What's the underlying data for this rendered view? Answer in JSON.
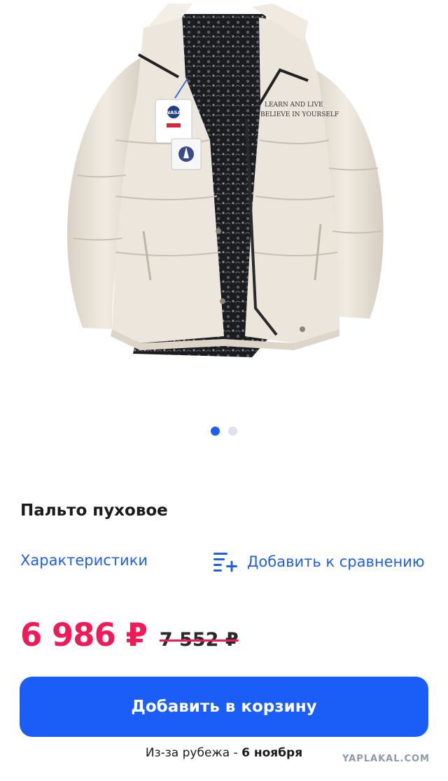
{
  "product": {
    "jacket_print_line1": "LEARN AND LIVE",
    "jacket_print_line2": "BELIEVE IN YOURSELF",
    "tag_brand": "NASA",
    "gallery": {
      "total_images": 2,
      "active_index": 0
    },
    "title": "Пальто пуховое",
    "specs_link": "Характеристики",
    "compare_label": "Добавить к сравнению",
    "price_current": "6 986 ₽",
    "price_old": "7 552 ₽",
    "add_to_cart": "Добавить в корзину",
    "delivery_prefix": "Из-за рубежа - ",
    "delivery_date": "6 ноября"
  },
  "watermark": "YAPLAKAL.COM",
  "colors": {
    "accent_blue": "#1a5ef7",
    "price_red": "#ef1a56",
    "jacket": "#ece6dc"
  }
}
